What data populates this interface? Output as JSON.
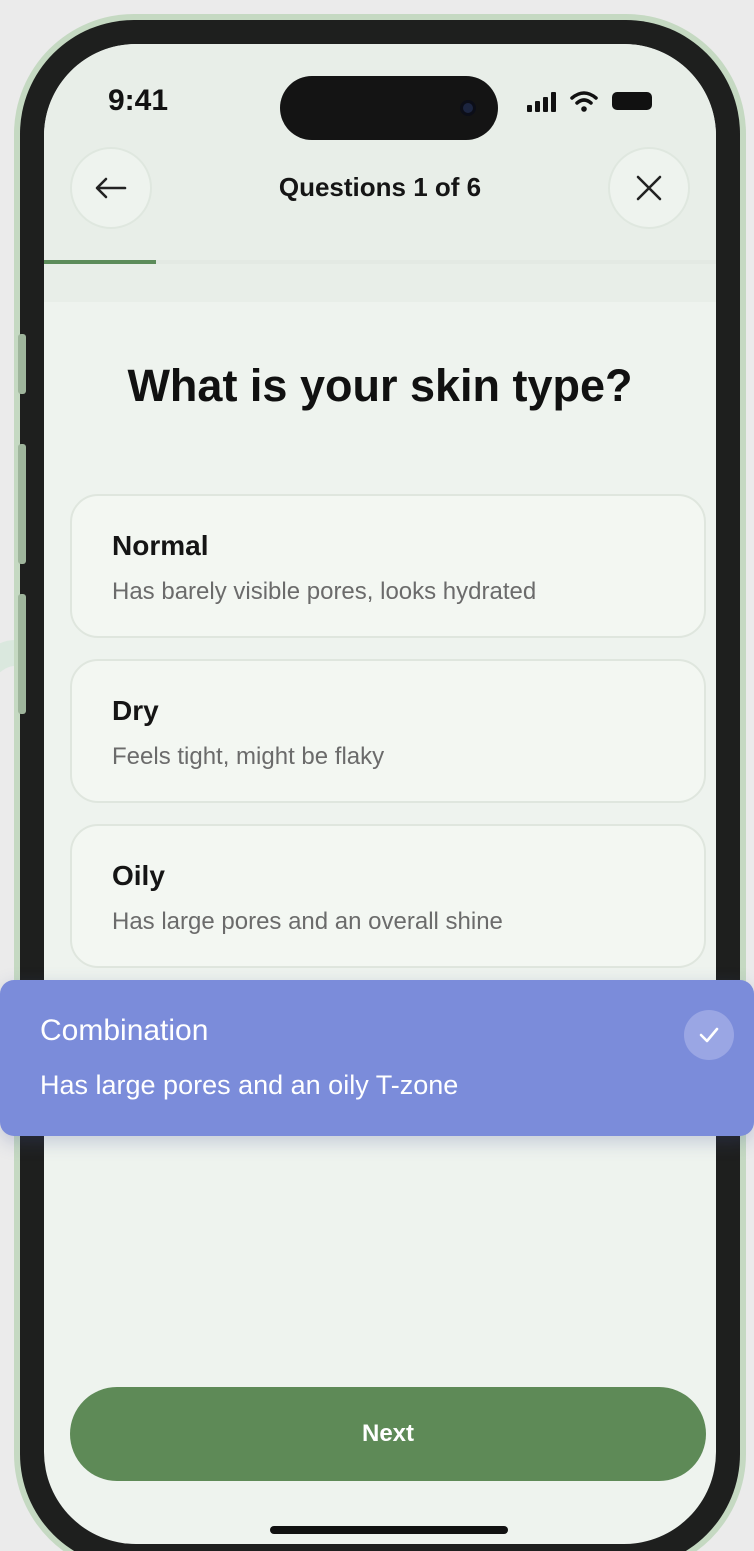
{
  "status_bar": {
    "time": "9:41"
  },
  "nav": {
    "title": "Questions 1 of 6",
    "back_icon": "arrow-left-icon",
    "close_icon": "close-icon"
  },
  "progress": {
    "current": 1,
    "total": 6,
    "fraction": 0.1667
  },
  "question": {
    "title": "What is your skin type?"
  },
  "options": [
    {
      "title": "Normal",
      "description": "Has barely visible pores, looks hydrated"
    },
    {
      "title": "Dry",
      "description": "Feels tight, might be flaky"
    },
    {
      "title": "Oily",
      "description": "Has large pores and an overall shine"
    }
  ],
  "selected_option": {
    "title": "Combination",
    "description": "Has large pores and an oily T-zone",
    "icon": "check-icon"
  },
  "footer": {
    "next_label": "Next"
  },
  "colors": {
    "accent_green": "#5e8a57",
    "selected_purple": "#7b8cda",
    "screen_bg": "#eef3ee"
  }
}
